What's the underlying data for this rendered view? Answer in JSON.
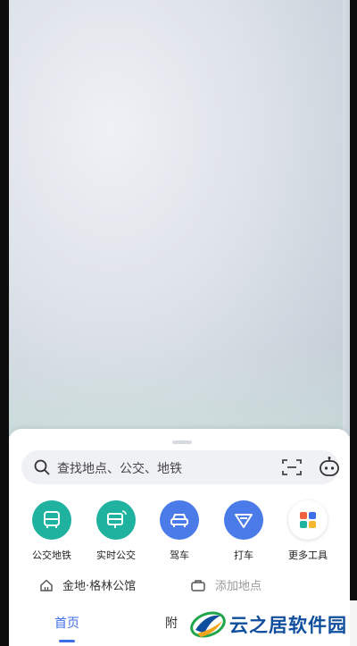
{
  "search": {
    "placeholder": "查找地点、公交、地铁"
  },
  "tools": [
    {
      "label": "公交地铁",
      "icon": "bus-icon",
      "color": "#1fb39f"
    },
    {
      "label": "实时公交",
      "icon": "realtime-bus-icon",
      "color": "#1fb39f"
    },
    {
      "label": "驾车",
      "icon": "car-icon",
      "color": "#4a7be8"
    },
    {
      "label": "打车",
      "icon": "taxi-icon",
      "color": "#4a7be8"
    },
    {
      "label": "更多工具",
      "icon": "more-tools-icon",
      "color": "#ffffff"
    }
  ],
  "places": {
    "home": "金地·格林公馆",
    "add": "添加地点"
  },
  "tabs": {
    "home": "首页",
    "nearby": "附"
  },
  "watermark": {
    "text": "云之居软件园"
  },
  "colors": {
    "accent": "#3e6ee8",
    "teal": "#1fb39f",
    "blue": "#4a7be8"
  }
}
